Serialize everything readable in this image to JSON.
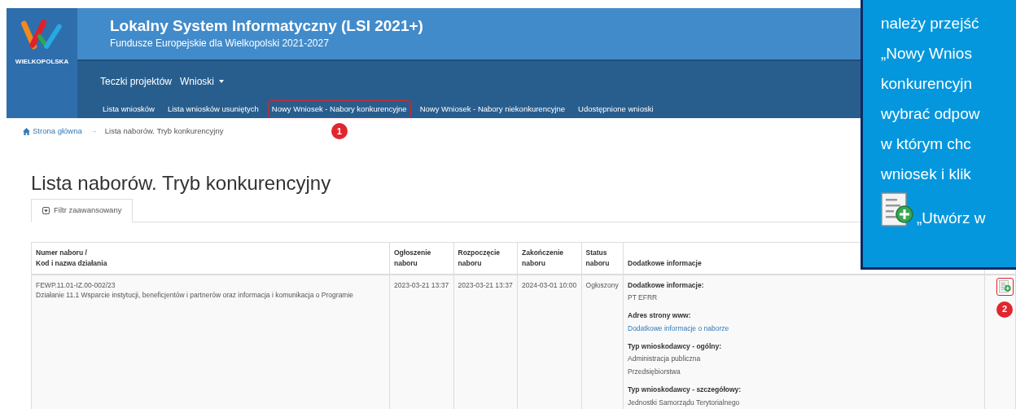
{
  "header": {
    "logo_text": "WIELKOPOLSKA",
    "title": "Lokalny System Informatyczny (LSI 2021+)",
    "subtitle": "Fundusze Europejskie dla Wielkopolski 2021-2027",
    "nav_main": [
      {
        "label": "Teczki projektów",
        "dropdown": false
      },
      {
        "label": "Wnioski",
        "dropdown": true
      }
    ],
    "nav_sub": [
      {
        "label": "Lista wniosków",
        "highlighted": false
      },
      {
        "label": "Lista wniosków usuniętych",
        "highlighted": false
      },
      {
        "label": "Nowy Wniosek - Nabory konkurencyjne",
        "highlighted": true,
        "marker": "1"
      },
      {
        "label": "Nowy Wniosek - Nabory niekonkurencyjne",
        "highlighted": false
      },
      {
        "label": "Udostępnione wnioski",
        "highlighted": false
      }
    ]
  },
  "breadcrumb_separator": "→",
  "breadcrumb": [
    {
      "label": "Strona główna",
      "kind": "home"
    },
    {
      "label": "Lista naborów. Tryb konkurencyjny",
      "kind": "current"
    }
  ],
  "page_title": "Lista naborów. Tryb konkurencyjny",
  "filter_tab": {
    "label": "Filtr zaawansowany"
  },
  "table": {
    "columns": [
      [
        "Numer naboru /",
        "Kod i nazwa działania"
      ],
      [
        "Ogłoszenie",
        "naboru"
      ],
      [
        "Rozpoczęcie",
        "naboru"
      ],
      [
        "Zakończenie",
        "naboru"
      ],
      [
        "Status",
        "naboru"
      ],
      [
        "Dodatkowe informacje"
      ]
    ],
    "rows": [
      {
        "number": "FEWP.11.01-IZ.00-002/23",
        "name": "Działanie 11.1 Wsparcie instytucji, beneficjentów i partnerów oraz informacja i komunikacja o Programie",
        "announced": "2023-03-21 13:37",
        "start": "2023-03-21 13:37",
        "end": "2024-03-01 10:00",
        "status": "Ogłoszony",
        "action_marker": "2",
        "info": [
          {
            "label": "Dodatkowe informacje:",
            "kind": "text",
            "values": [
              "PT EFRR"
            ]
          },
          {
            "label": "Adres strony www:",
            "kind": "link",
            "values": [
              "Dodatkowe informacje o naborze"
            ]
          },
          {
            "label": "Typ wnioskodawcy - ogólny:",
            "kind": "text",
            "values": [
              "Administracja publiczna",
              "Przedsiębiorstwa"
            ]
          },
          {
            "label": "Typ wnioskodawcy - szczegółowy:",
            "kind": "text",
            "values": [
              "Jednostki Samorządu Terytorialnego"
            ]
          }
        ]
      }
    ]
  },
  "callout": {
    "lines": [
      "należy przejść",
      "„Nowy Wnios",
      "konkurencyjn",
      "wybrać odpow",
      "w którym chc",
      "wniosek i klik"
    ],
    "icon_line": "„Utwórz w"
  }
}
